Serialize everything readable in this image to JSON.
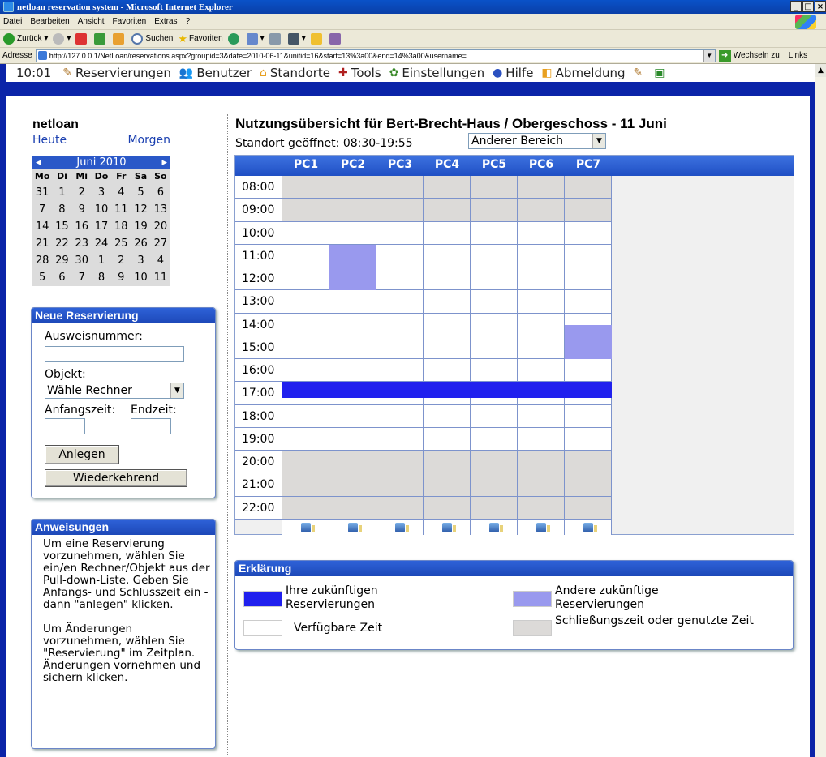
{
  "browser": {
    "title": "netloan reservation system - Microsoft Internet Explorer",
    "menu": [
      "Datei",
      "Bearbeiten",
      "Ansicht",
      "Favoriten",
      "Extras",
      "?"
    ],
    "toolbar": {
      "back": "Zurück",
      "search": "Suchen",
      "favorites": "Favoriten"
    },
    "address_label": "Adresse",
    "address": "http://127.0.0.1/NetLoan/reservations.aspx?groupid=3&date=2010-06-11&unitid=16&start=13%3a00&end=14%3a00&username=",
    "go": "Wechseln zu",
    "links": "Links"
  },
  "nav": {
    "time": "10:01",
    "items": [
      {
        "label": "Reservierungen",
        "icon": "pen-icon"
      },
      {
        "label": "Benutzer",
        "icon": "users-icon"
      },
      {
        "label": "Standorte",
        "icon": "locations-icon"
      },
      {
        "label": "Tools",
        "icon": "tools-icon"
      },
      {
        "label": "Einstellungen",
        "icon": "settings-icon"
      },
      {
        "label": "Hilfe",
        "icon": "help-icon"
      },
      {
        "label": "Abmeldung",
        "icon": "logout-icon"
      }
    ]
  },
  "sidebar": {
    "brand": "netloan",
    "today": "Heute",
    "tomorrow": "Morgen",
    "calendar": {
      "month": "Juni 2010",
      "weekdays": [
        "Mo",
        "Di",
        "Mi",
        "Do",
        "Fr",
        "Sa",
        "So"
      ],
      "weeks": [
        [
          "31",
          "1",
          "2",
          "3",
          "4",
          "5",
          "6"
        ],
        [
          "7",
          "8",
          "9",
          "10",
          "11",
          "12",
          "13"
        ],
        [
          "14",
          "15",
          "16",
          "17",
          "18",
          "19",
          "20"
        ],
        [
          "21",
          "22",
          "23",
          "24",
          "25",
          "26",
          "27"
        ],
        [
          "28",
          "29",
          "30",
          "1",
          "2",
          "3",
          "4"
        ],
        [
          "5",
          "6",
          "7",
          "8",
          "9",
          "10",
          "11"
        ]
      ]
    },
    "new_reservation": {
      "heading": "Neue Reservierung",
      "card_label": "Ausweisnummer:",
      "card_value": "",
      "object_label": "Objekt:",
      "object_selected": "Wähle Rechner",
      "start_label": "Anfangszeit:",
      "end_label": "Endzeit:",
      "start_value": "",
      "end_value": "",
      "create_button": "Anlegen",
      "recurring_button": "Wiederkehrend"
    },
    "instructions": {
      "heading": "Anweisungen",
      "para1": "Um eine Reservierung vorzunehmen, wählen Sie ein/en Rechner/Objekt aus der Pull-down-Liste. Geben Sie Anfangs- und Schlusszeit ein - dann \"anlegen\" klicken.",
      "para2": "Um Änderungen vorzunehmen, wählen Sie \"Reservierung\" im Zeitplan. Änderungen vornehmen und sichern klicken."
    }
  },
  "main": {
    "title": "Nutzungsübersicht für Bert-Brecht-Haus / Obergeschoss - 11 Juni",
    "opening": "Standort geöffnet: 08:30-19:55",
    "area_selected": "Anderer Bereich",
    "schedule": {
      "pcs": [
        "PC1",
        "PC2",
        "PC3",
        "PC4",
        "PC5",
        "PC6",
        "PC7"
      ],
      "hours": [
        "08:00",
        "09:00",
        "10:00",
        "11:00",
        "12:00",
        "13:00",
        "14:00",
        "15:00",
        "16:00",
        "17:00",
        "18:00",
        "19:00",
        "20:00",
        "21:00",
        "22:00"
      ],
      "closed_hours": [
        "08:00",
        "09:00",
        "20:00",
        "21:00",
        "22:00"
      ],
      "reservations": [
        {
          "pc": "PC2",
          "start": 11.0,
          "end": 13.0,
          "type": "other"
        },
        {
          "pc": "PC7",
          "start": 14.5,
          "end": 16.0,
          "type": "other"
        },
        {
          "pc": "all",
          "start": 17.0,
          "end": 17.7,
          "type": "own"
        }
      ]
    },
    "legend": {
      "heading": "Erklärung",
      "own": "Ihre zukünftigen Reservierungen",
      "other": "Andere zukünftige Reservierungen",
      "available": "Verfügbare Zeit",
      "closed": "Schließungszeit oder genutzte Zeit"
    }
  },
  "colors": {
    "own": "#2020ee",
    "other": "#9999ee",
    "available": "#ffffff",
    "closed": "#dcdad8",
    "accent": "#0b24a8"
  }
}
